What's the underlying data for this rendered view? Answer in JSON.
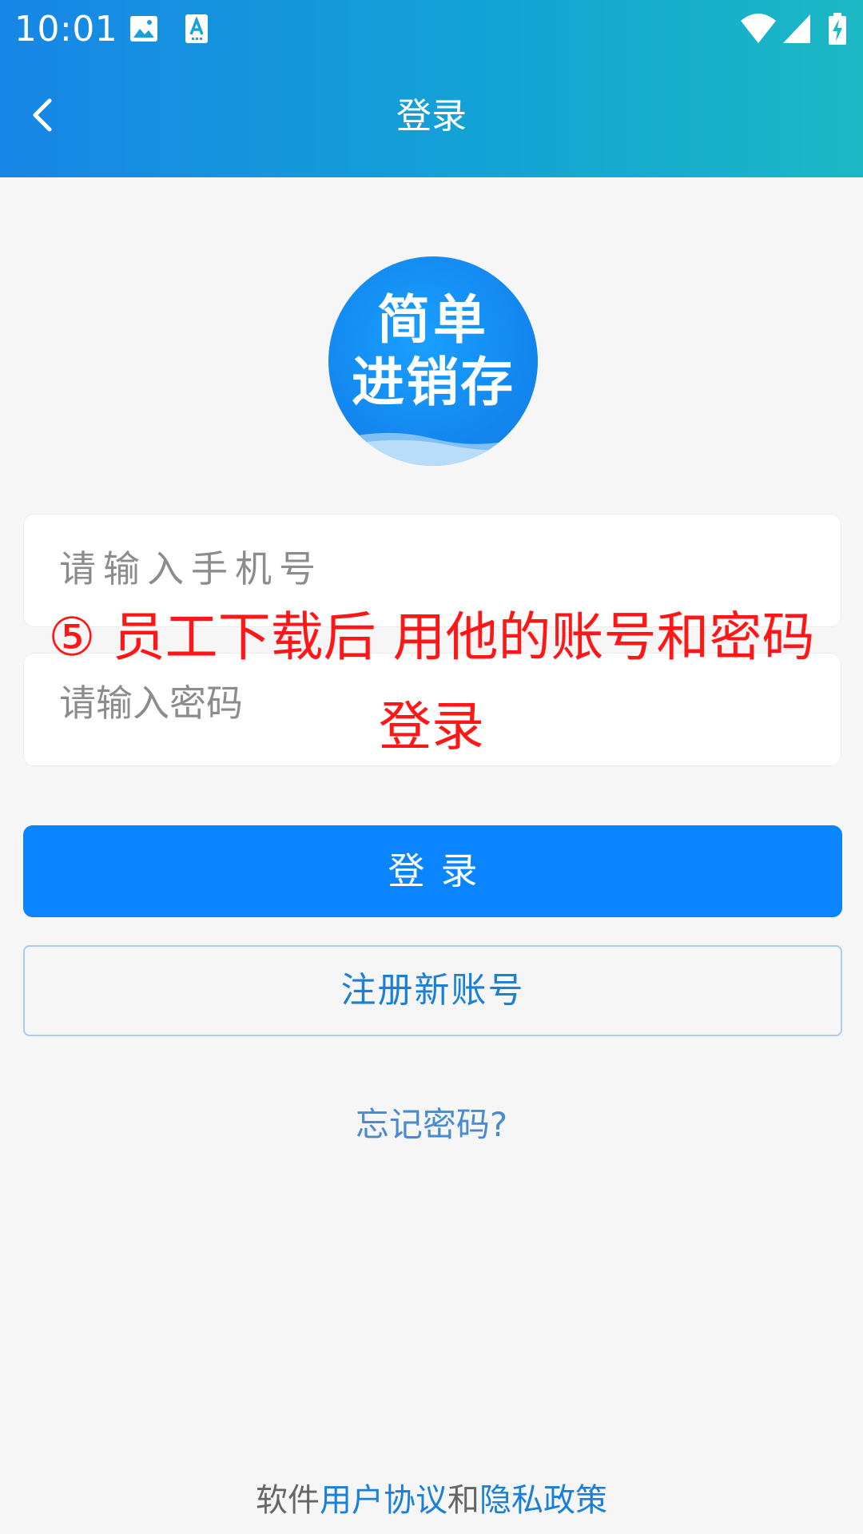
{
  "status_bar": {
    "time": "10:01",
    "icons": [
      "image-icon",
      "text-icon",
      "wifi-icon",
      "signal-icon",
      "battery-charging-icon"
    ]
  },
  "app_bar": {
    "title": "登录",
    "back_icon": "chevron-left-icon"
  },
  "logo": {
    "line1": "简单",
    "line2": "进销存"
  },
  "form": {
    "phone_placeholder": "请输入手机号",
    "password_placeholder": "请输入密码",
    "login_label": "登录",
    "register_label": "注册新账号",
    "forgot_label": "忘记密码?"
  },
  "annotation": {
    "text": "⑤ 员工下载后 用他的账号和密码登录"
  },
  "footer": {
    "prefix": "软件",
    "user_agreement": "用户协议",
    "conjunction": "和",
    "privacy_policy": "隐私政策"
  },
  "colors": {
    "header_gradient_start": "#1786e6",
    "header_gradient_end": "#1bb8c4",
    "primary": "#0a84ff",
    "link": "#1a7fd9",
    "annotation": "#ff1616",
    "background": "#f6f6f6"
  }
}
